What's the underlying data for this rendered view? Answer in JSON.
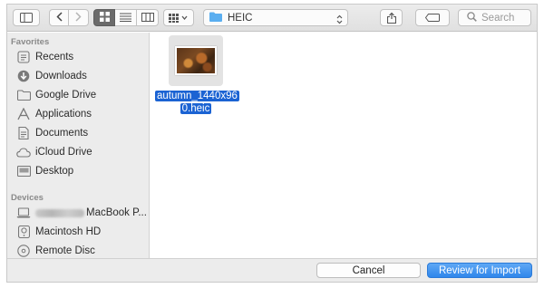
{
  "toolbar": {
    "sidebar_toggle_icon": "sidebar-icon",
    "back_icon": "chevron-left-icon",
    "forward_icon": "chevron-right-icon",
    "view_modes": [
      "icon-view",
      "list-view",
      "column-view"
    ],
    "active_view": "icon-view",
    "arrange_icon": "grid-arrange-icon",
    "path_folder": "HEIC",
    "share_icon": "share-icon",
    "tag_icon": "tag-icon",
    "search_placeholder": "Search"
  },
  "sidebar": {
    "favorites_heading": "Favorites",
    "favorites": [
      {
        "label": "Recents",
        "icon": "recents-icon"
      },
      {
        "label": "Downloads",
        "icon": "downloads-icon"
      },
      {
        "label": "Google Drive",
        "icon": "folder-icon"
      },
      {
        "label": "Applications",
        "icon": "applications-icon"
      },
      {
        "label": "Documents",
        "icon": "documents-icon"
      },
      {
        "label": "iCloud Drive",
        "icon": "cloud-icon"
      },
      {
        "label": "Desktop",
        "icon": "desktop-icon"
      }
    ],
    "devices_heading": "Devices",
    "devices": [
      {
        "label": "MacBook P...",
        "icon": "laptop-icon"
      },
      {
        "label": "Macintosh HD",
        "icon": "harddisk-icon"
      },
      {
        "label": "Remote Disc",
        "icon": "disc-icon"
      }
    ]
  },
  "content": {
    "file": {
      "name_line1": "autumn_1440x96",
      "name_line2": "0.heic",
      "selected": true
    }
  },
  "footer": {
    "cancel_label": "Cancel",
    "import_label": "Review for Import"
  },
  "colors": {
    "accent": "#1b63d3",
    "primary_button": "#2f86eb",
    "folder_blue": "#5aaef0"
  }
}
